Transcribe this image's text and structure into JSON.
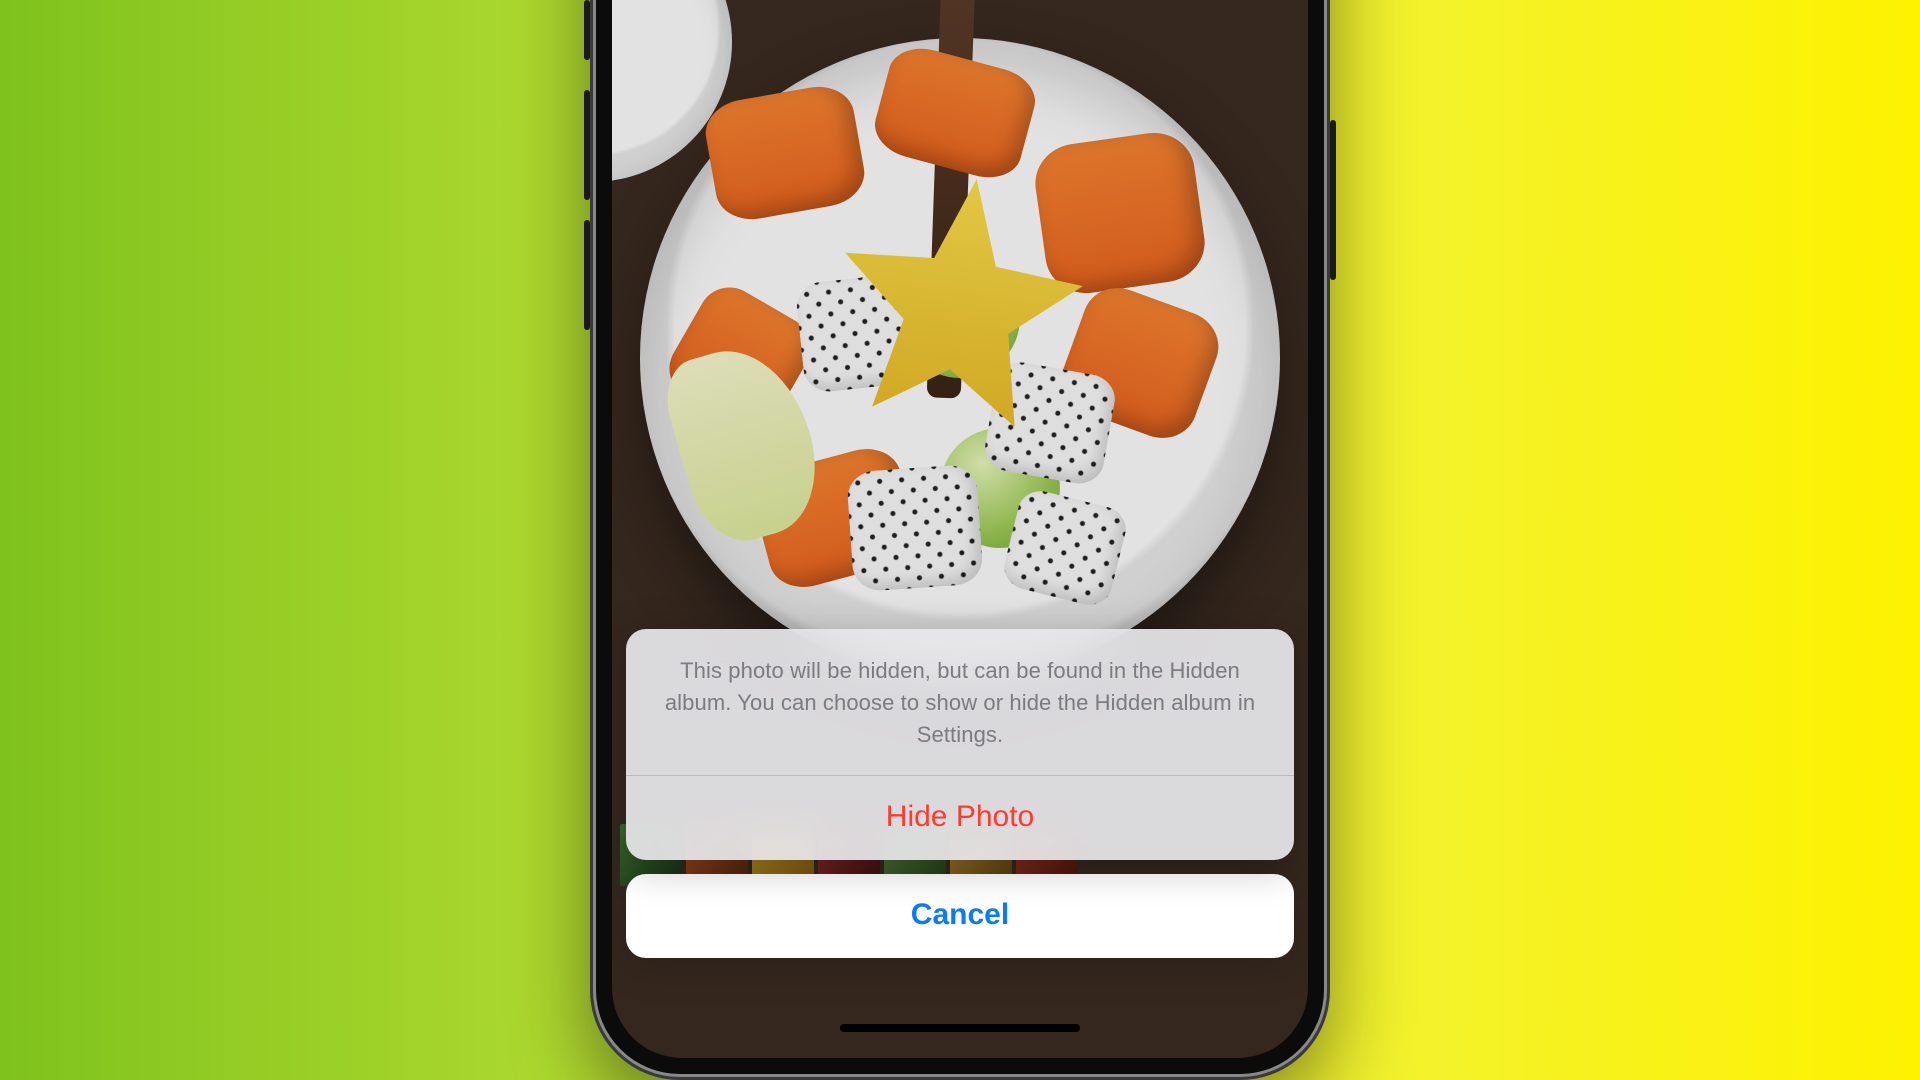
{
  "action_sheet": {
    "message": "This photo will be hidden, but can be found in the Hidden album. You can choose to show or hide the Hidden album in Settings.",
    "destructive_action_label": "Hide Photo",
    "cancel_label": "Cancel"
  }
}
